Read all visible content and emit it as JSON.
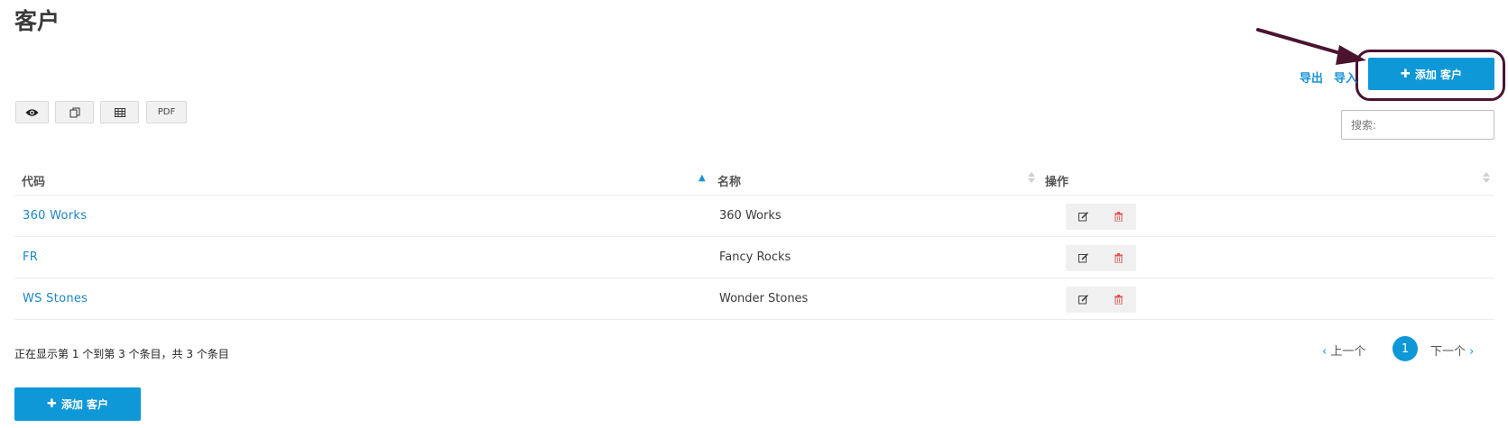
{
  "page": {
    "title": "客户"
  },
  "toolbar": {
    "export_label": "导出",
    "import_label": "导入",
    "add_button_label": "添加 客户"
  },
  "export_buttons": {
    "view_icon": "eye-icon",
    "copy_icon": "copy-icon",
    "excel_icon": "table-icon",
    "pdf_label": "PDF"
  },
  "search": {
    "placeholder": "搜索:"
  },
  "table": {
    "columns": [
      "代码",
      "名称",
      "操作"
    ],
    "rows": [
      {
        "code": "360 Works",
        "name": "360 Works"
      },
      {
        "code": "FR",
        "name": "Fancy Rocks"
      },
      {
        "code": "WS Stones",
        "name": "Wonder Stones"
      }
    ],
    "action_icons": [
      "edit-icon",
      "trash-icon"
    ]
  },
  "footer": {
    "info": "正在显示第 1 个到第 3 个条目，共 3 个条目",
    "prev_label": "上一个",
    "current_page": "1",
    "next_label": "下一个"
  },
  "colors": {
    "accent": "#0e98d8",
    "link": "#1b86c4",
    "delete": "#e05555",
    "annotation": "#4a1430"
  }
}
